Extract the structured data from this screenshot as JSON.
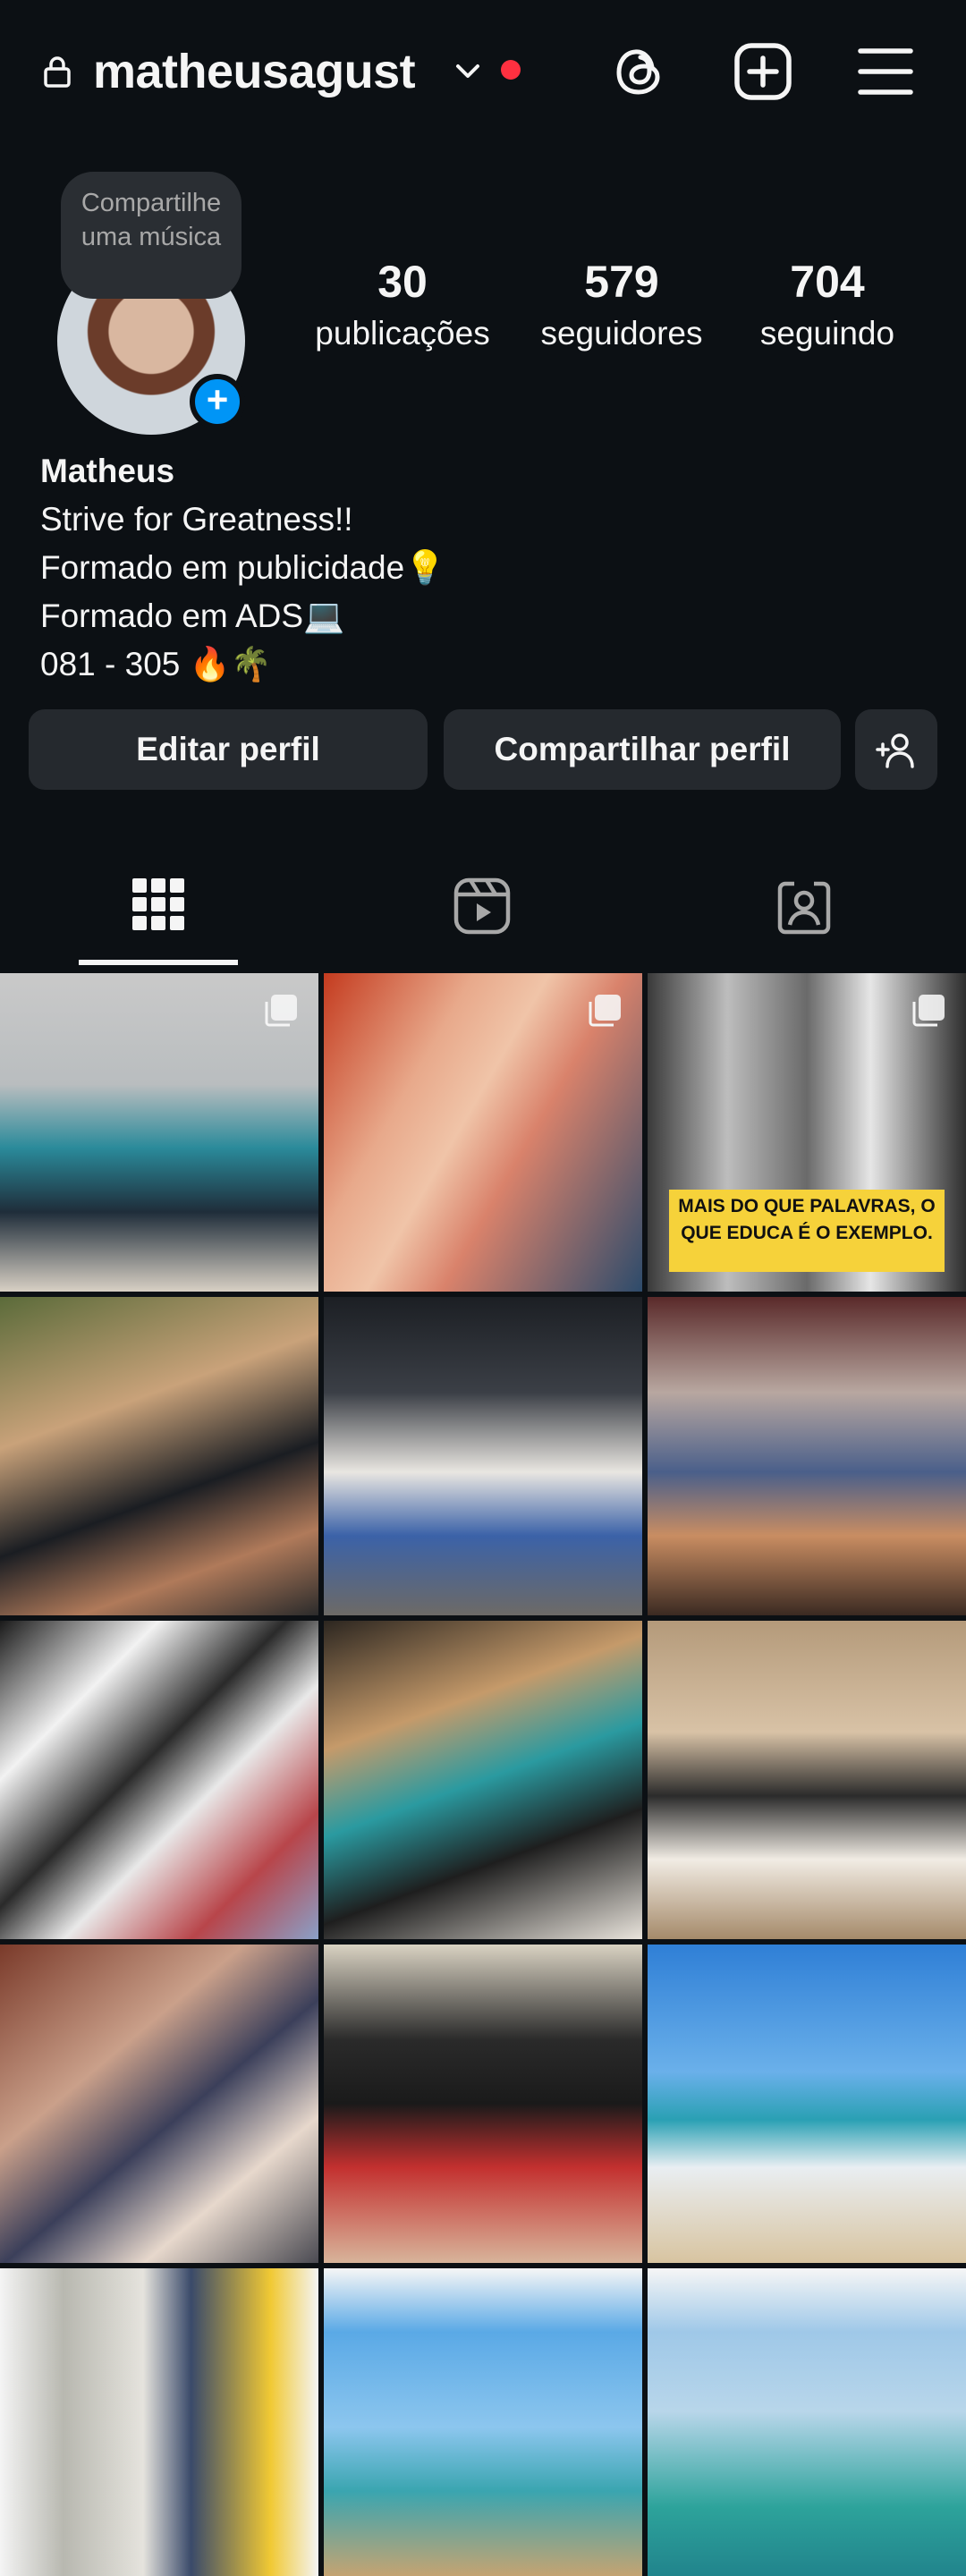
{
  "header": {
    "username": "matheusagust"
  },
  "profile": {
    "note": "Compartilhe uma música",
    "stats": [
      {
        "value": "30",
        "label": "publicações"
      },
      {
        "value": "579",
        "label": "seguidores"
      },
      {
        "value": "704",
        "label": "seguindo"
      }
    ],
    "bio": {
      "name": "Matheus",
      "lines": [
        "Strive for Greatness!!",
        "Formado em publicidade💡",
        "Formado em ADS💻",
        "081 - 305 🔥🌴"
      ]
    }
  },
  "actions": {
    "edit": "Editar perfil",
    "share": "Compartilhar perfil"
  },
  "grid": {
    "banner_text": "MAIS DO QUE PALAVRAS, O QUE EDUCA É O EXEMPLO."
  },
  "colors": {
    "background": "#0c1014",
    "button": "#25292e",
    "accent": "#0095f6",
    "notification": "#ff3040"
  }
}
